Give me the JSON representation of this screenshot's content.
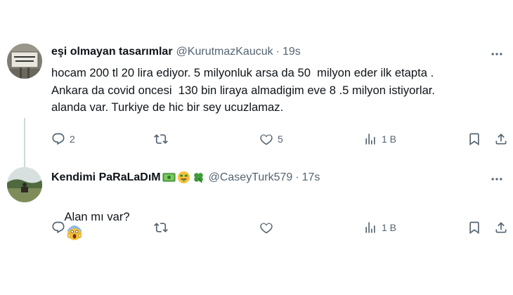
{
  "tweets": [
    {
      "name": "eşi olmayan tasarımlar",
      "handle": "@KurutmazKaucuk",
      "dot": "·",
      "time": "19s",
      "text": "hocam 200 tl 20 lira ediyor. 5 milyonluk arsa da 50  milyon eder ilk etapta .\nAnkara da covid oncesi  130 bin liraya almadigim eve 8 .5 milyon istiyorlar.\nalanda var. Turkiye de hic bir sey ucuzlamaz.",
      "avatar_text": "EN MÜHENDİS KİM MİSİN?",
      "replies": "2",
      "retweets": "",
      "likes": "5",
      "views": "1 B"
    },
    {
      "name": "Kendimi PaRaLaDıM",
      "name_emojis": [
        "money-bill-icon",
        "money-face-icon",
        "clover-icon"
      ],
      "handle": "@CaseyTurk579",
      "dot": "·",
      "time": "17s",
      "text": "Alan mı var?",
      "text_emoji": "screaming-face-icon",
      "replies": "",
      "retweets": "",
      "likes": "",
      "views": "1 B"
    }
  ],
  "colors": {
    "text": "#0f1419",
    "muted": "#536471",
    "thread_line": "#cfd9de",
    "background": "#ffffff"
  },
  "icons": [
    "reply-icon",
    "retweet-icon",
    "like-icon",
    "views-icon",
    "bookmark-icon",
    "share-icon",
    "more-icon"
  ]
}
